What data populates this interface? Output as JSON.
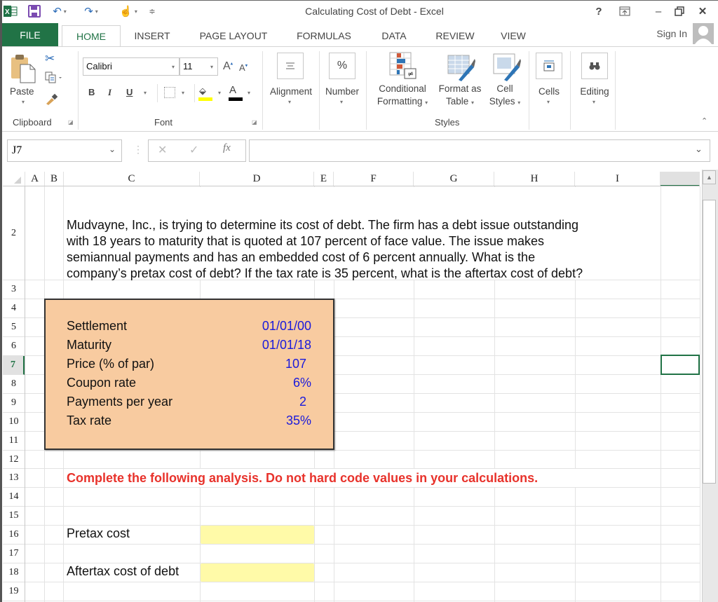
{
  "window": {
    "title": "Calculating Cost of Debt - Excel",
    "controls": {
      "help": "?",
      "ribbon_options": "⇱",
      "minimize": "–",
      "restore": "🗗",
      "close": "✕"
    }
  },
  "quick_access": {
    "app_icon": "excel-icon",
    "save": "save-icon",
    "undo": "undo-icon",
    "redo": "redo-icon",
    "touch_mode": "touch-mode-icon",
    "customize": "customize-qat-icon"
  },
  "tabs": [
    {
      "label": "FILE",
      "active": false
    },
    {
      "label": "HOME",
      "active": true
    },
    {
      "label": "INSERT",
      "active": false
    },
    {
      "label": "PAGE LAYOUT",
      "active": false
    },
    {
      "label": "FORMULAS",
      "active": false
    },
    {
      "label": "DATA",
      "active": false
    },
    {
      "label": "REVIEW",
      "active": false
    },
    {
      "label": "VIEW",
      "active": false
    }
  ],
  "account": {
    "sign_in": "Sign In"
  },
  "ribbon": {
    "clipboard": {
      "group_label": "Clipboard",
      "paste": "Paste"
    },
    "font": {
      "group_label": "Font",
      "font_name": "Calibri",
      "font_size": "11",
      "bold": "B",
      "italic": "I",
      "underline": "U",
      "fill_color": "#ffff00",
      "font_color": "#000000"
    },
    "alignment": {
      "label": "Alignment"
    },
    "number": {
      "label": "Number",
      "icon_text": "%"
    },
    "styles": {
      "group_label": "Styles",
      "conditional_formatting": [
        "Conditional",
        "Formatting"
      ],
      "format_as_table": [
        "Format as",
        "Table"
      ],
      "cell_styles": [
        "Cell",
        "Styles"
      ]
    },
    "cells": {
      "label": "Cells"
    },
    "editing": {
      "label": "Editing"
    }
  },
  "formula_bar": {
    "name_box": "J7",
    "cancel": "✕",
    "enter": "✓",
    "fx": "fx",
    "formula": ""
  },
  "sheet": {
    "columns": [
      "A",
      "B",
      "C",
      "D",
      "E",
      "F",
      "G",
      "H",
      "I",
      ""
    ],
    "rows": [
      "2",
      "3",
      "4",
      "5",
      "6",
      "7",
      "8",
      "9",
      "10",
      "11",
      "12",
      "13",
      "14",
      "15",
      "16",
      "17",
      "18",
      "19"
    ],
    "active_row": "7",
    "prompt_lines": [
      "Mudvayne, Inc., is trying to determine its cost of debt. The firm has a debt issue outstanding",
      "with 18 years to maturity that is quoted at 107 percent of face value. The issue makes",
      "semiannual payments and has an embedded cost of 6 percent annually. What is the",
      "company’s pretax cost of debt? If the tax rate is 35 percent, what is the aftertax cost of debt?"
    ],
    "inputs": [
      {
        "label": "Settlement",
        "value": "01/01/00"
      },
      {
        "label": "Maturity",
        "value": "01/01/18"
      },
      {
        "label": "Price (% of par)",
        "value": "107"
      },
      {
        "label": "Coupon rate",
        "value": "6%"
      },
      {
        "label": "Payments per year",
        "value": "2"
      },
      {
        "label": "Tax rate",
        "value": "35%"
      }
    ],
    "instruction": "Complete the following analysis. Do not hard code values in your calculations.",
    "outputs": [
      {
        "label": "Pretax cost",
        "value": ""
      },
      {
        "label": "Aftertax cost of debt",
        "value": ""
      }
    ]
  },
  "colors": {
    "excel_green": "#217346",
    "input_box_fill": "#f8cba0",
    "input_value_text": "#1a1adb",
    "instruction_text": "#e8322b",
    "answer_cell_fill": "#fffaa8"
  }
}
